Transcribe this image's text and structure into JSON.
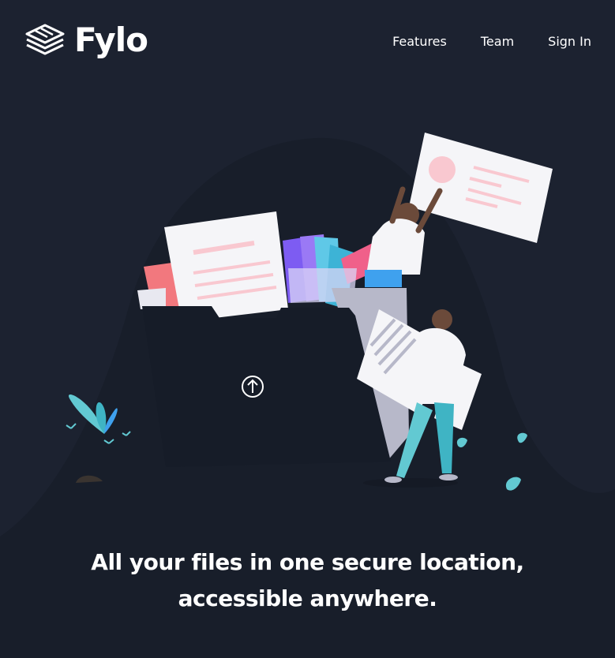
{
  "header": {
    "logo_text": "Fylo",
    "nav": [
      {
        "label": "Features"
      },
      {
        "label": "Team"
      },
      {
        "label": "Sign In"
      }
    ]
  },
  "hero": {
    "headline_line1": "All your files in one secure location,",
    "headline_line2": "accessible anywhere."
  },
  "colors": {
    "background": "#1c2230",
    "curve": "#181e2a",
    "accent_cyan": "#62e0d9",
    "accent_blue": "#3fa1ee",
    "text": "#ffffff"
  },
  "icons": {
    "logo": "stacked-layers-icon",
    "upload": "upload-arrow-icon"
  }
}
